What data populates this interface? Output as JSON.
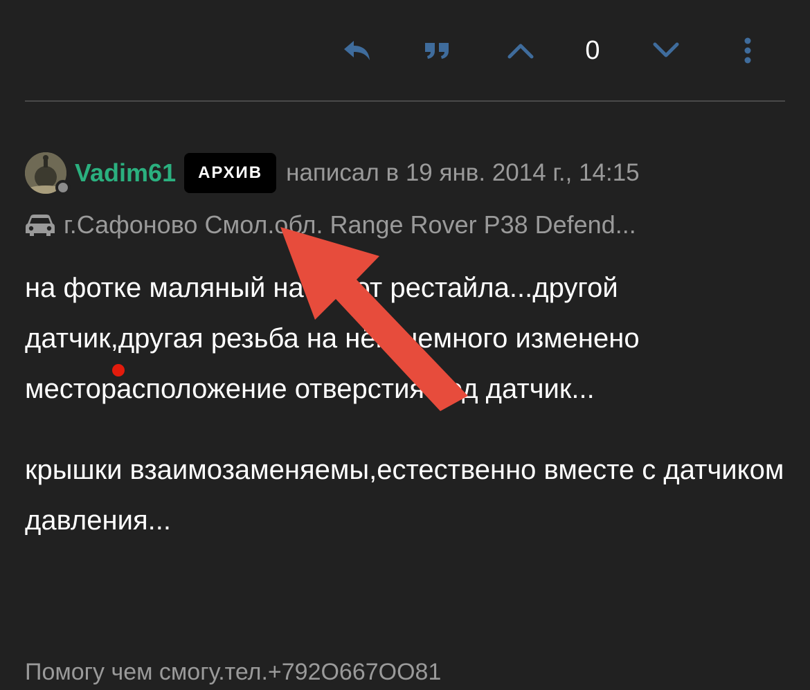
{
  "actions": {
    "reply_icon": "reply-icon",
    "quote_icon": "quote-icon",
    "upvote_icon": "chevron-up-icon",
    "score": "0",
    "downvote_icon": "chevron-down-icon",
    "more_icon": "more-vertical-icon"
  },
  "post": {
    "author": "Vadim61",
    "badge": "АРХИВ",
    "meta": "написал в 19 янв. 2014 г., 14:15",
    "location": "г.Сафоново Смол.обл. Range Rover P38 Defend...",
    "paragraphs": [
      "на фотке маляный насос от рестайла...другой датчик,другая резьба на нём,немного изменено месторасположение отверстия под датчик...",
      "крышки взаимозаменяемы,естественно вместе с датчиком давления..."
    ],
    "signature": "Помогу чем смогу.тел.+792О667ОО81"
  },
  "colors": {
    "background": "#212121",
    "action_icon": "#3f6c9c",
    "username": "#2bb07f",
    "muted_text": "#9a9a9a",
    "badge_bg": "#000000",
    "annotation_arrow": "#e74c3c"
  }
}
